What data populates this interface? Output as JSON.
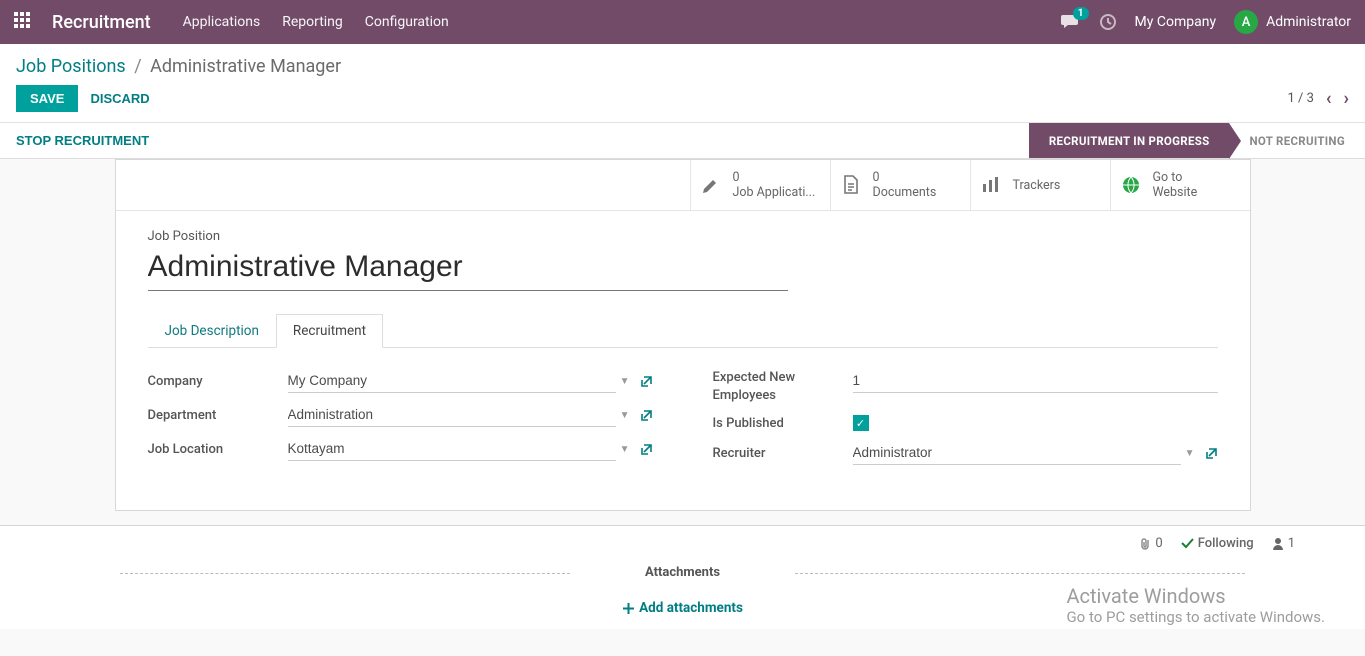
{
  "navbar": {
    "brand": "Recruitment",
    "menu": [
      "Applications",
      "Reporting",
      "Configuration"
    ],
    "msg_count": "1",
    "company": "My Company",
    "user_initial": "A",
    "user_name": "Administrator"
  },
  "breadcrumb": {
    "root": "Job Positions",
    "current": "Administrative Manager"
  },
  "actions": {
    "save": "SAVE",
    "discard": "DISCARD"
  },
  "pager": {
    "text": "1 / 3"
  },
  "status": {
    "stop_btn": "STOP RECRUITMENT",
    "active": "RECRUITMENT IN PROGRESS",
    "inactive": "NOT RECRUITING"
  },
  "stat_buttons": {
    "applications": {
      "count": "0",
      "label": "Job Applicati..."
    },
    "documents": {
      "count": "0",
      "label": "Documents"
    },
    "trackers": {
      "label": "Trackers"
    },
    "website": {
      "line1": "Go to",
      "line2": "Website"
    }
  },
  "title": {
    "label": "Job Position",
    "value": "Administrative Manager"
  },
  "tabs": {
    "job_desc": "Job Description",
    "recruitment": "Recruitment"
  },
  "form": {
    "left": {
      "company": {
        "label": "Company",
        "value": "My Company"
      },
      "department": {
        "label": "Department",
        "value": "Administration"
      },
      "location": {
        "label": "Job Location",
        "value": "Kottayam"
      }
    },
    "right": {
      "expected": {
        "label": "Expected New Employees",
        "value": "1"
      },
      "published": {
        "label": "Is Published"
      },
      "recruiter": {
        "label": "Recruiter",
        "value": "Administrator"
      }
    }
  },
  "chatter": {
    "attach_count": "0",
    "following": "Following",
    "follower_count": "1",
    "attachments_header": "Attachments",
    "add_attachments": "Add attachments"
  },
  "watermark": {
    "line1": "Activate Windows",
    "line2": "Go to PC settings to activate Windows."
  }
}
